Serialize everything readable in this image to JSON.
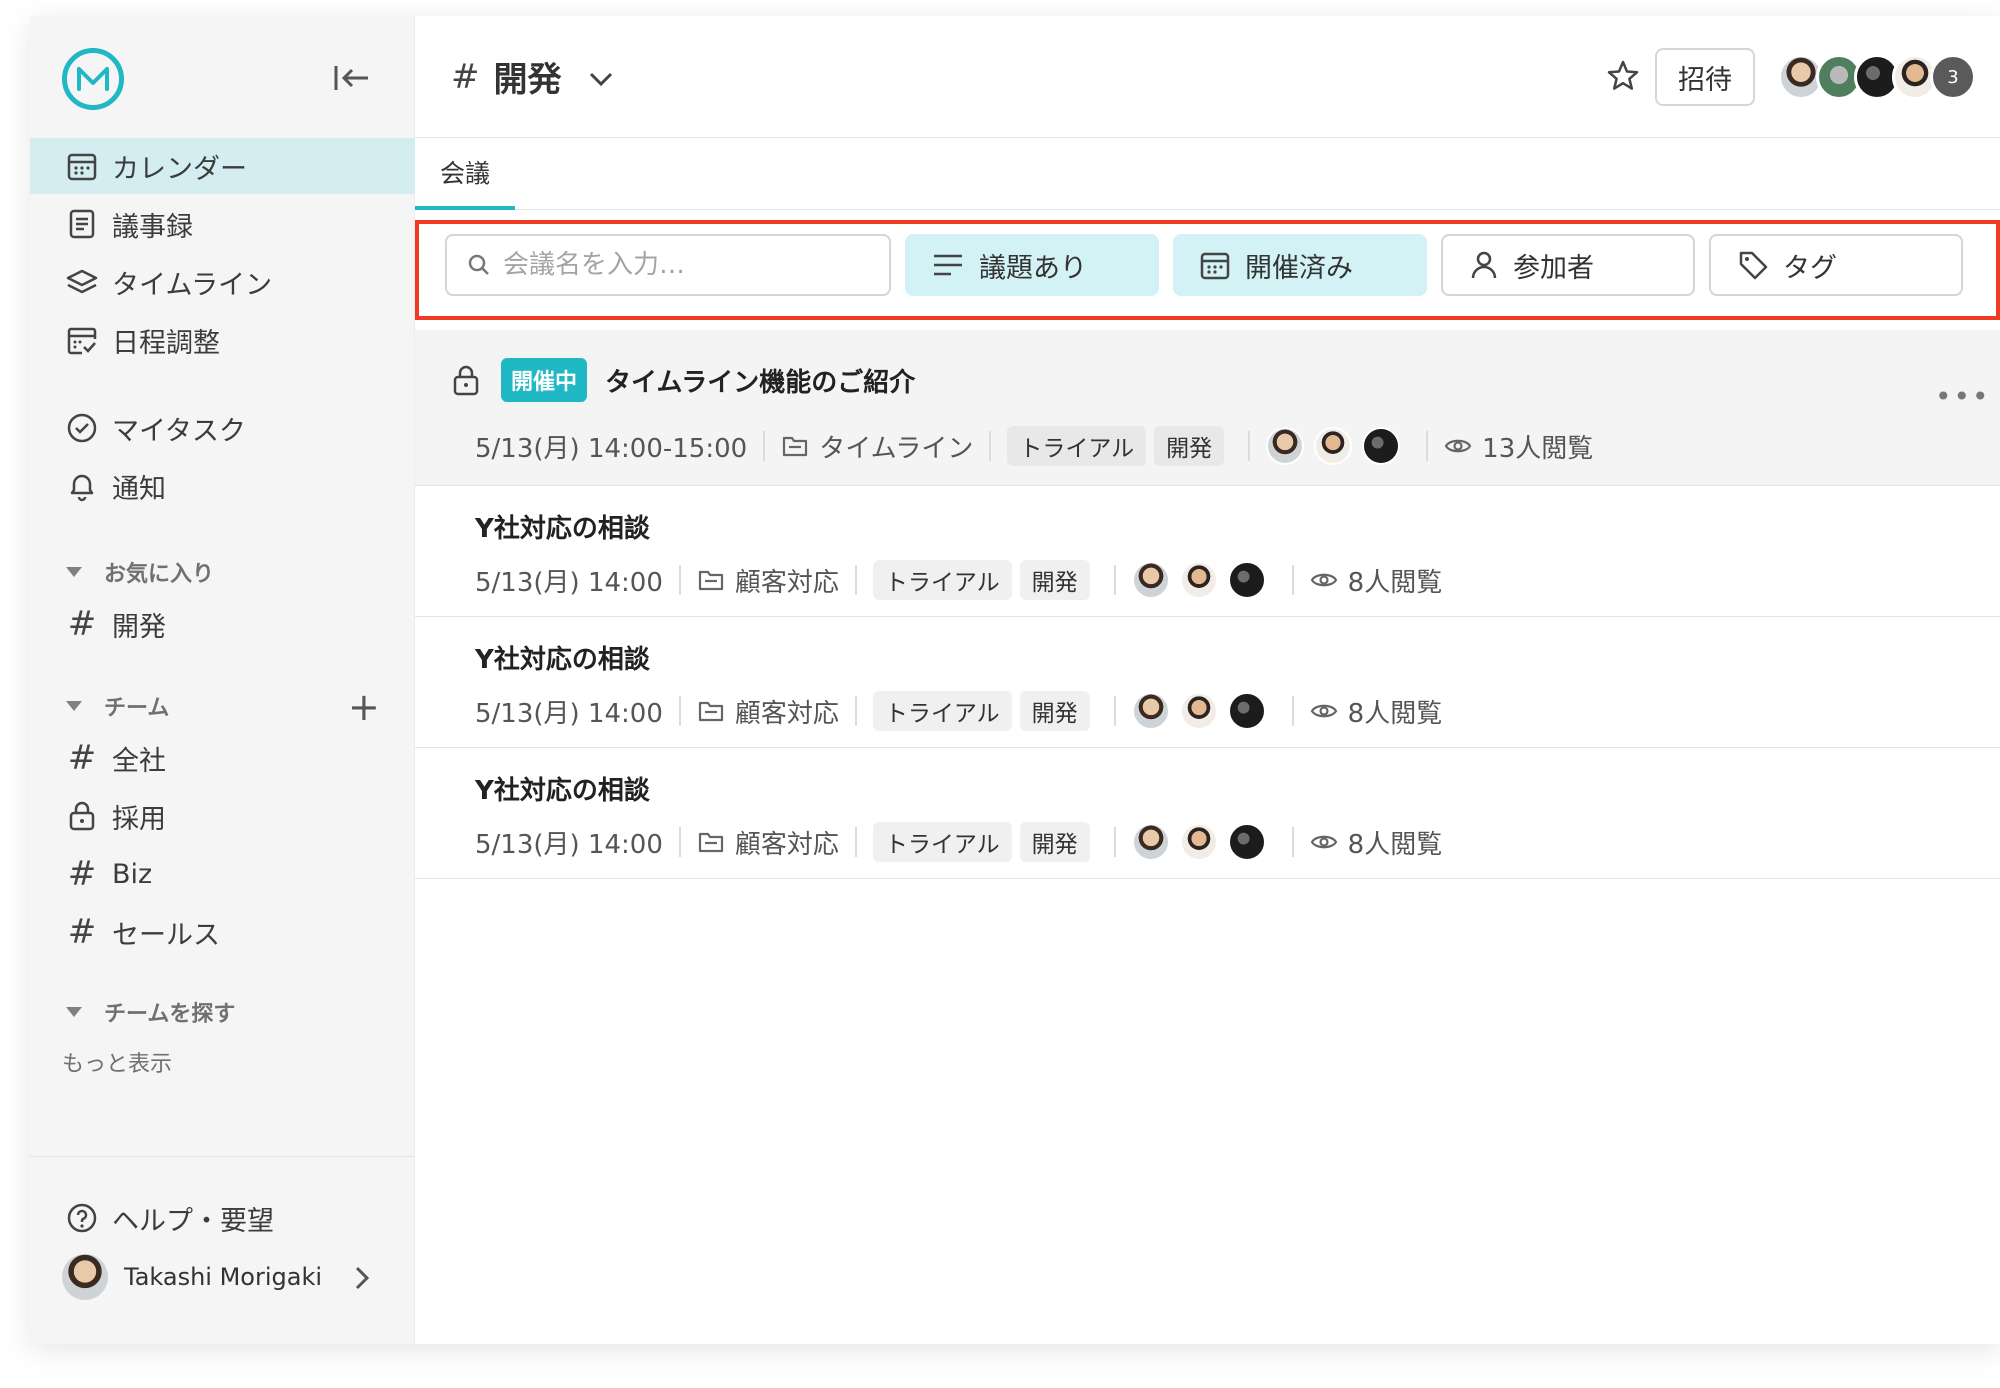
{
  "sidebar": {
    "nav": [
      {
        "label": "カレンダー",
        "icon": "calendar-icon",
        "active": true
      },
      {
        "label": "議事録",
        "icon": "document-icon",
        "active": false
      },
      {
        "label": "タイムライン",
        "icon": "layers-icon",
        "active": false
      },
      {
        "label": "日程調整",
        "icon": "schedule-icon",
        "active": false
      }
    ],
    "nav2": [
      {
        "label": "マイタスク",
        "icon": "check-circle-icon"
      },
      {
        "label": "通知",
        "icon": "bell-icon"
      }
    ],
    "favorites": {
      "title": "お気に入り",
      "items": [
        {
          "label": "開発",
          "icon": "hash-icon"
        }
      ]
    },
    "teams": {
      "title": "チーム",
      "items": [
        {
          "label": "全社",
          "icon": "hash-icon"
        },
        {
          "label": "採用",
          "icon": "lock-icon"
        },
        {
          "label": "Biz",
          "icon": "hash-icon"
        },
        {
          "label": "セールス",
          "icon": "hash-icon"
        }
      ]
    },
    "find_teams": "チームを探す",
    "show_more": "もっと表示",
    "help": "ヘルプ・要望",
    "user_name": "Takashi Morigaki"
  },
  "header": {
    "channel": "開発",
    "invite": "招待",
    "member_count_badge": "3"
  },
  "tabs": [
    {
      "label": "会議"
    }
  ],
  "filters": {
    "search_placeholder": "会議名を入力…",
    "agenda": "議題あり",
    "held": "開催済み",
    "participants": "参加者",
    "tags": "タグ"
  },
  "meetings": [
    {
      "status": "開催中",
      "title": "タイムライン機能のご紹介",
      "datetime": "5/13(月) 14:00-15:00",
      "folder": "タイムライン",
      "tags": [
        "トライアル",
        "開発"
      ],
      "views": "13人閲覧"
    },
    {
      "status": "",
      "title": "Y社対応の相談",
      "datetime": "5/13(月) 14:00",
      "folder": "顧客対応",
      "tags": [
        "トライアル",
        "開発"
      ],
      "views": "8人閲覧"
    },
    {
      "status": "",
      "title": "Y社対応の相談",
      "datetime": "5/13(月) 14:00",
      "folder": "顧客対応",
      "tags": [
        "トライアル",
        "開発"
      ],
      "views": "8人閲覧"
    },
    {
      "status": "",
      "title": "Y社対応の相談",
      "datetime": "5/13(月) 14:00",
      "folder": "顧客対応",
      "tags": [
        "トライアル",
        "開発"
      ],
      "views": "8人閲覧"
    }
  ],
  "colors": {
    "accent": "#1fb8c4",
    "active_bg": "#d4edf1",
    "highlight_border": "#ef3b24"
  }
}
